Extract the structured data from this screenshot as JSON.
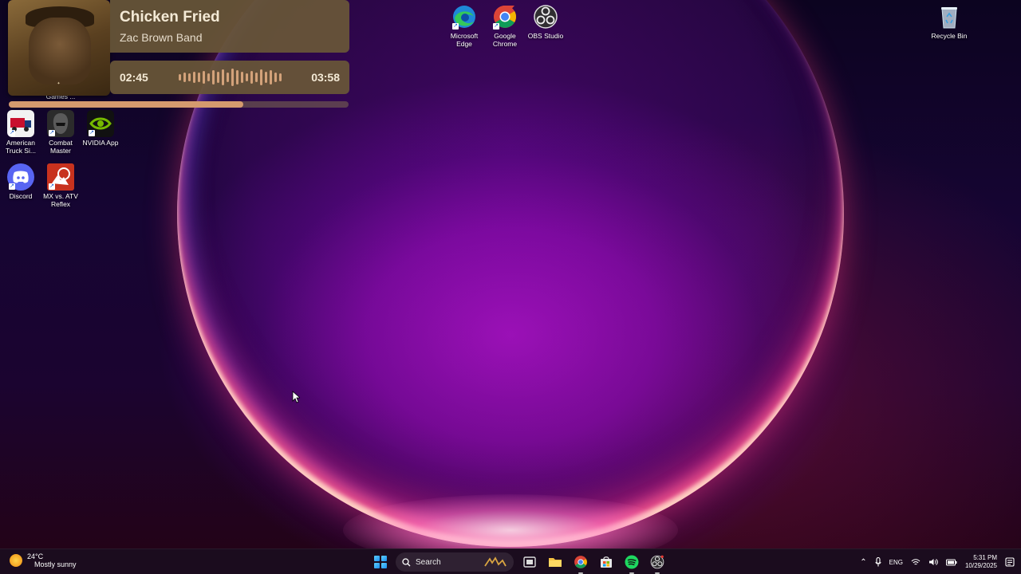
{
  "desktop": {
    "icons": [
      {
        "label": "Microsoft Edge",
        "icon": "edge-icon"
      },
      {
        "label": "Google Chrome",
        "icon": "chrome-icon"
      },
      {
        "label": "OBS Studio",
        "icon": "obs-icon"
      },
      {
        "label": "Recycle Bin",
        "icon": "recycle-bin-icon"
      },
      {
        "label": "American Truck Si...",
        "icon": "american-truck-simulator-icon"
      },
      {
        "label": "Combat Master",
        "icon": "combat-master-icon"
      },
      {
        "label": "NVIDIA App",
        "icon": "nvidia-icon"
      },
      {
        "label": "Discord",
        "icon": "discord-icon"
      },
      {
        "label": "MX vs. ATV Reflex",
        "icon": "mx-vs-atv-icon"
      },
      {
        "label": "Games ...",
        "icon": "games-folder-icon"
      }
    ]
  },
  "music_widget": {
    "title": "Chicken Fried",
    "artist": "Zac Brown Band",
    "elapsed": "02:45",
    "duration": "03:58",
    "progress_fraction": 0.69,
    "album_art": "album-cover-the-foundation"
  },
  "taskbar": {
    "weather": {
      "temp": "24°C",
      "condition": "Mostly sunny",
      "icon": "sun-icon"
    },
    "search_label": "Search",
    "apps": [
      "windows-start-icon",
      "search-icon",
      "task-view-icon",
      "file-explorer-icon",
      "chrome-icon",
      "microsoft-store-icon",
      "spotify-icon",
      "obs-icon"
    ],
    "tray": {
      "language": "ENG",
      "time": "5:31 PM",
      "date": "10/29/2025"
    }
  },
  "colors": {
    "widget_bg": "#685638",
    "progress_fill": "#d49a6e",
    "accent": "#1a8ef0"
  }
}
